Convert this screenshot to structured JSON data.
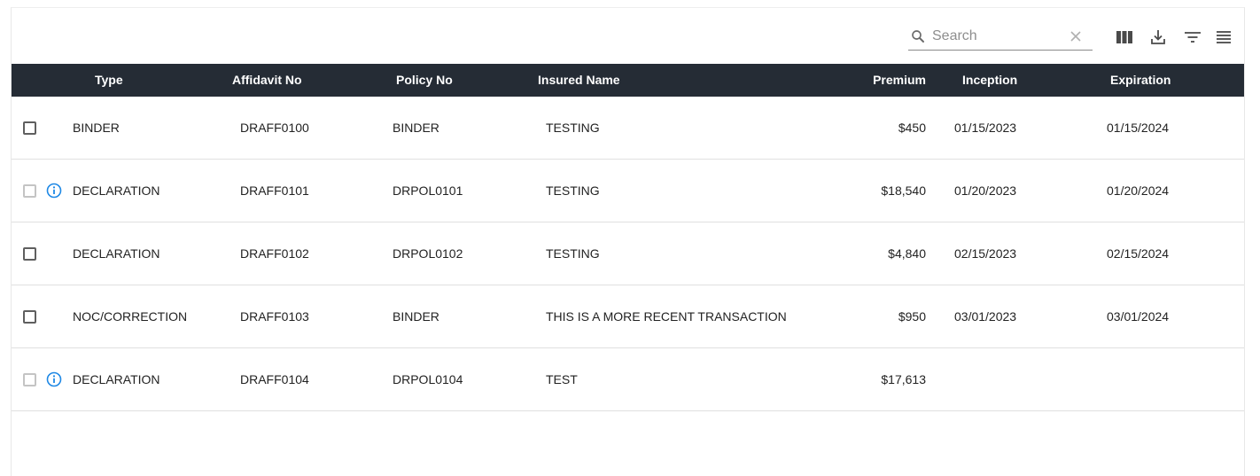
{
  "toolbar": {
    "search_placeholder": "Search",
    "search_value": "",
    "icons": [
      "search-icon",
      "clear-icon",
      "columns-icon",
      "download-icon",
      "filter-icon",
      "density-icon"
    ]
  },
  "columns": [
    "Type",
    "Affidavit No",
    "Policy No",
    "Insured Name",
    "Premium",
    "Inception",
    "Expiration"
  ],
  "rows": [
    {
      "type": "BINDER",
      "affidavit": "DRAFF0100",
      "policy": "BINDER",
      "insured": "TESTING",
      "premium": "$450",
      "inception": "01/15/2023",
      "expiration": "01/15/2024",
      "info": false,
      "checkbox_enabled": true
    },
    {
      "type": "DECLARATION",
      "affidavit": "DRAFF0101",
      "policy": "DRPOL0101",
      "insured": "TESTING",
      "premium": "$18,540",
      "inception": "01/20/2023",
      "expiration": "01/20/2024",
      "info": true,
      "checkbox_enabled": false
    },
    {
      "type": "DECLARATION",
      "affidavit": "DRAFF0102",
      "policy": "DRPOL0102",
      "insured": "TESTING",
      "premium": "$4,840",
      "inception": "02/15/2023",
      "expiration": "02/15/2024",
      "info": false,
      "checkbox_enabled": true
    },
    {
      "type": "NOC/CORRECTION",
      "affidavit": "DRAFF0103",
      "policy": "BINDER",
      "insured": "THIS IS A MORE RECENT TRANSACTION",
      "premium": "$950",
      "inception": "03/01/2023",
      "expiration": "03/01/2024",
      "info": false,
      "checkbox_enabled": true
    },
    {
      "type": "DECLARATION",
      "affidavit": "DRAFF0104",
      "policy": "DRPOL0104",
      "insured": "TEST",
      "premium": "$17,613",
      "inception": "",
      "expiration": "",
      "info": true,
      "checkbox_enabled": false
    }
  ],
  "colors": {
    "header_bg": "#252c35",
    "info_accent": "#1e88e5",
    "row_divider": "#e0e0e0"
  }
}
